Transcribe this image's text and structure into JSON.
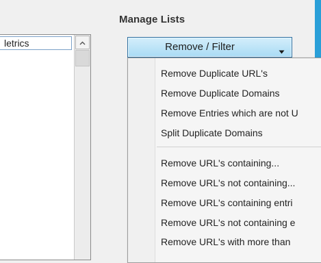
{
  "left_list": {
    "selected_item": "letrics"
  },
  "group": {
    "title": "Manage Lists"
  },
  "dropdown": {
    "label": "Remove / Filter",
    "caret_icon": "caret-down-icon",
    "items_group1": [
      "Remove Duplicate URL's",
      "Remove Duplicate Domains",
      "Remove Entries which are not U",
      "Split Duplicate Domains"
    ],
    "items_group2": [
      "Remove URL's containing...",
      "Remove URL's not containing...",
      "Remove URL's containing entri",
      "Remove URL's not containing e",
      "Remove URL's with more than"
    ]
  },
  "colors": {
    "accent": "#2a9fd8",
    "button_fill": "#a9dbf4",
    "button_border": "#2f6f9f"
  }
}
